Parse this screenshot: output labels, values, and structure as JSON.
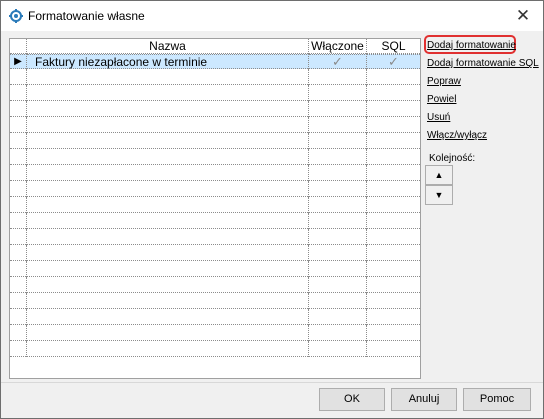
{
  "window": {
    "title": "Formatowanie własne",
    "close_glyph": "✕",
    "icon": "gear-app-icon"
  },
  "grid": {
    "columns": [
      "Nazwa",
      "Włączone",
      "SQL"
    ],
    "rows": [
      {
        "name": "Faktury niezapłacone w terminie",
        "enabled": "✓",
        "sql": "✓",
        "selected": true
      }
    ],
    "empty_rows": 18,
    "row_pointer": "▶"
  },
  "actions": {
    "add": "Dodaj formatowanie",
    "add_sql": "Dodaj formatowanie SQL",
    "edit": "Popraw",
    "duplicate": "Powiel",
    "delete": "Usuń",
    "toggle": "Włącz/wyłącz"
  },
  "order": {
    "label": "Kolejność:",
    "up": "▲",
    "down": "▼"
  },
  "buttons": {
    "ok": "OK",
    "cancel": "Anuluj",
    "help": "Pomoc"
  },
  "colors": {
    "selection": "#cce8ff",
    "highlight": "#e03030"
  }
}
